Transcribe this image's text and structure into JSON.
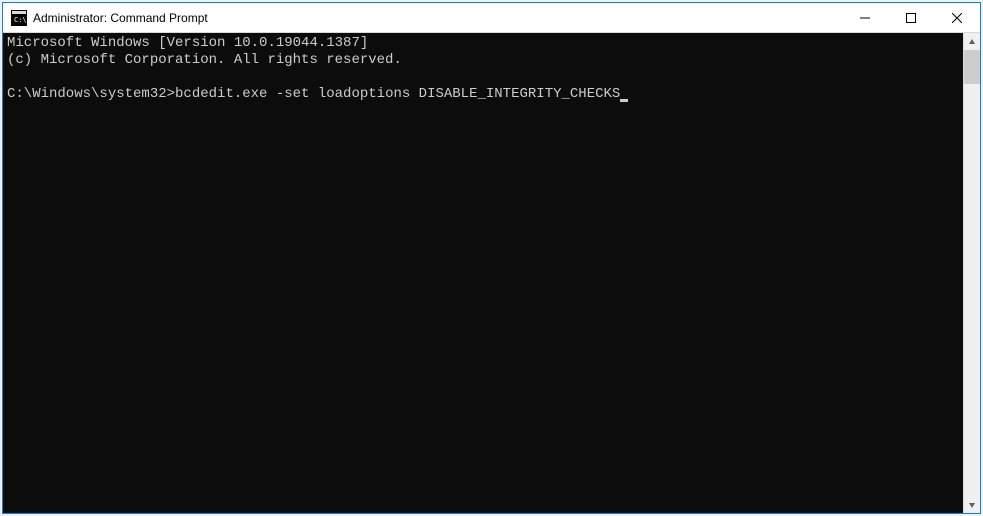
{
  "title": "Administrator: Command Prompt",
  "console": {
    "line1": "Microsoft Windows [Version 10.0.19044.1387]",
    "line2": "(c) Microsoft Corporation. All rights reserved.",
    "blank": "",
    "prompt": "C:\\Windows\\system32>",
    "command": "bcdedit.exe -set loadoptions DISABLE_INTEGRITY_CHECKS"
  }
}
